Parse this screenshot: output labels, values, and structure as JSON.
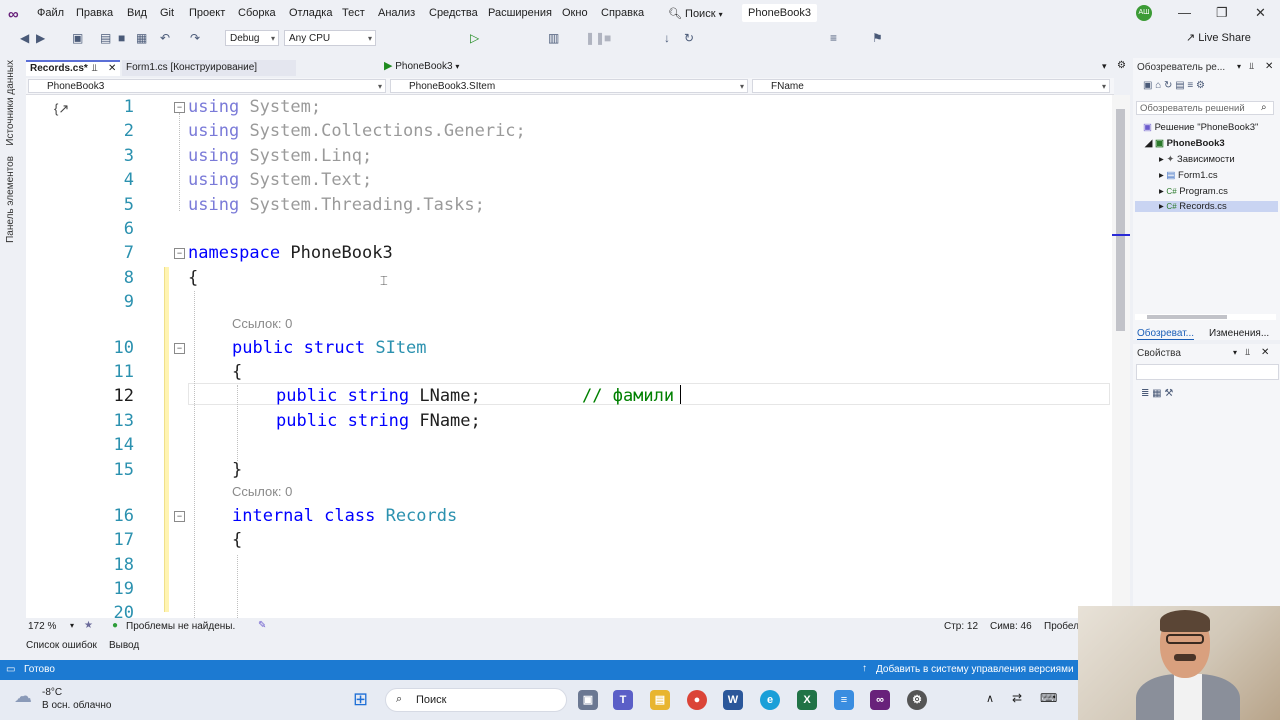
{
  "app": {
    "menu": [
      "Файл",
      "Правка",
      "Вид",
      "Git",
      "Проект",
      "Сборка",
      "Отладка",
      "Тест",
      "Анализ",
      "Средства",
      "Расширения",
      "Окно",
      "Справка"
    ],
    "search_label": "Поиск",
    "solution_name": "PhoneBook3",
    "avatar_initials": "АШ",
    "accent_color": "#68217a"
  },
  "toolbar": {
    "config": "Debug",
    "platform": "Any CPU",
    "run_target": "PhoneBook3",
    "live_share": "Live Share"
  },
  "left_strip": {
    "tabs": [
      "Источники данных",
      "Панель элементов"
    ]
  },
  "tabs": [
    {
      "label": "Records.cs*",
      "active": true
    },
    {
      "label": "Form1.cs [Конструирование]",
      "active": false
    }
  ],
  "navbar": {
    "project": "PhoneBook3",
    "type": "PhoneBook3.SItem",
    "member": "FName"
  },
  "editor": {
    "line_numbers": [
      "1",
      "2",
      "3",
      "4",
      "5",
      "6",
      "7",
      "8",
      "9",
      "10",
      "11",
      "12",
      "13",
      "14",
      "15",
      "16",
      "17",
      "18",
      "19",
      "20"
    ],
    "codelens_refs": [
      "Ссылок: 0",
      "Ссылок: 0"
    ],
    "tokens": {
      "using": "using",
      "ns1": "System;",
      "ns2": "System.Collections.Generic;",
      "ns3": "System.Linq;",
      "ns4": "System.Text;",
      "ns5": "System.Threading.Tasks;",
      "namespace_kw": "namespace",
      "namespace_name": "PhoneBook3",
      "open_brace": "{",
      "close_brace": "}",
      "public": "public",
      "struct": "struct",
      "struct_name": "SItem",
      "string": "string",
      "field1": "LName;",
      "field2": "FName;",
      "comment": "// фамили",
      "internal": "internal",
      "class": "class",
      "class_name": "Records"
    }
  },
  "editor_status": {
    "zoom": "172 %",
    "problems": "Проблемы не найдены.",
    "line": "Стр: 12",
    "col": "Симв: 46",
    "trailing": "Пробел"
  },
  "bottom_tabs": [
    "Список ошибок",
    "Вывод"
  ],
  "statusbar": {
    "ready": "Готово",
    "source_control": "Добавить в систему управления версиями"
  },
  "solution_explorer": {
    "title": "Обозреватель ре...",
    "search_placeholder": "Обозреватель решений",
    "items": [
      {
        "label": "Решение \"PhoneBook3\"",
        "icon": "solution-icon"
      },
      {
        "label": "PhoneBook3",
        "icon": "csharp-project-icon"
      },
      {
        "label": "Зависимости",
        "icon": "dependencies-icon"
      },
      {
        "label": "Form1.cs",
        "icon": "form-icon"
      },
      {
        "label": "Program.cs",
        "icon": "csharp-file-icon"
      },
      {
        "label": "Records.cs",
        "icon": "csharp-file-icon"
      }
    ],
    "bottom_tabs": [
      "Обозреват...",
      "Изменения..."
    ]
  },
  "properties": {
    "title": "Свойства"
  },
  "taskbar": {
    "temperature": "-8°C",
    "weather": "В осн. облачно",
    "search": "Поиск"
  }
}
